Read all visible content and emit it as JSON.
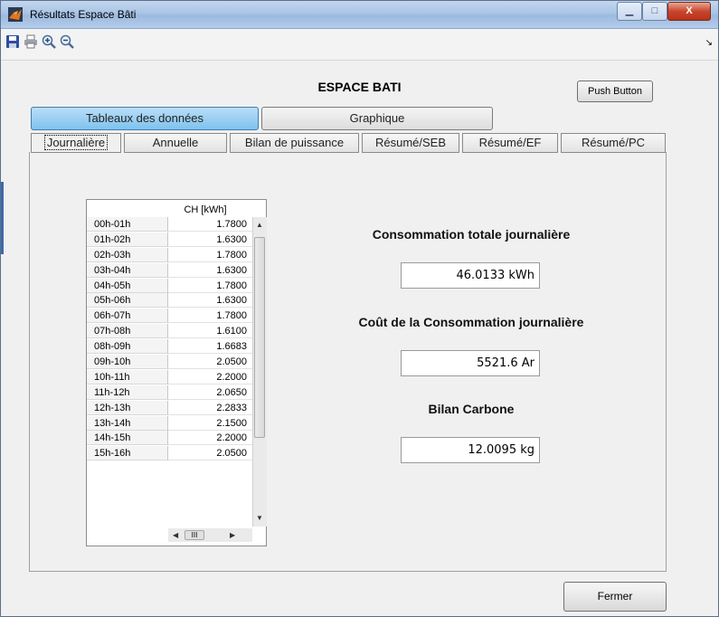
{
  "window": {
    "title": "Résultats Espace Bâti",
    "minimize_label": "▁",
    "maximize_label": "□",
    "close_label": "X"
  },
  "toolbar": {
    "icons": [
      "save-icon",
      "print-icon",
      "zoom-in-icon",
      "zoom-out-icon"
    ],
    "dock_arrow": "↘"
  },
  "heading": "ESPACE BATI",
  "push_button": "Push Button",
  "main_tabs": [
    {
      "label": "Tableaux des données",
      "active": true
    },
    {
      "label": "Graphique",
      "active": false
    }
  ],
  "sub_tabs": [
    {
      "label": "Journalière",
      "active": true
    },
    {
      "label": "Annuelle",
      "active": false
    },
    {
      "label": "Bilan de puissance",
      "active": false
    },
    {
      "label": "Résumé/SEB",
      "active": false
    },
    {
      "label": "Résumé/EF",
      "active": false
    },
    {
      "label": "Résumé/PC",
      "active": false
    }
  ],
  "table": {
    "column_header": "CH [kWh]",
    "rows": [
      {
        "hour": "00h-01h",
        "value": "1.7800"
      },
      {
        "hour": "01h-02h",
        "value": "1.6300"
      },
      {
        "hour": "02h-03h",
        "value": "1.7800"
      },
      {
        "hour": "03h-04h",
        "value": "1.6300"
      },
      {
        "hour": "04h-05h",
        "value": "1.7800"
      },
      {
        "hour": "05h-06h",
        "value": "1.6300"
      },
      {
        "hour": "06h-07h",
        "value": "1.7800"
      },
      {
        "hour": "07h-08h",
        "value": "1.6100"
      },
      {
        "hour": "08h-09h",
        "value": "1.6683"
      },
      {
        "hour": "09h-10h",
        "value": "2.0500"
      },
      {
        "hour": "10h-11h",
        "value": "2.2000"
      },
      {
        "hour": "11h-12h",
        "value": "2.0650"
      },
      {
        "hour": "12h-13h",
        "value": "2.2833"
      },
      {
        "hour": "13h-14h",
        "value": "2.1500"
      },
      {
        "hour": "14h-15h",
        "value": "2.2000"
      },
      {
        "hour": "15h-16h",
        "value": "2.0500"
      }
    ],
    "hscroll_thumb": "III"
  },
  "summary": {
    "total_label": "Consommation totale journalière",
    "total_value": "46.0133  kWh",
    "cost_label": "Coût de la Consommation journalière",
    "cost_value": "5521.6  Ar",
    "carbon_label": "Bilan Carbone",
    "carbon_value": "12.0095  kg"
  },
  "close_button": "Fermer",
  "colors": {
    "active_tab": "#7ec2ee",
    "titlebar": "#a9c4e6",
    "close_red": "#c8462d"
  }
}
